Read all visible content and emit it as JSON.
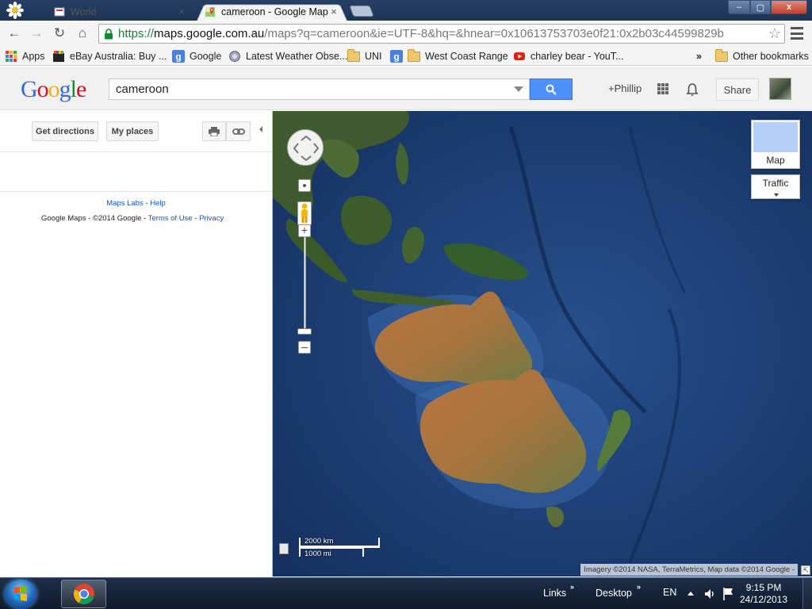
{
  "browser": {
    "tabs": [
      {
        "label": "World",
        "active": false
      },
      {
        "label": "cameroon - Google Maps",
        "active": true
      }
    ],
    "close_glyph": "×",
    "window_controls": {
      "minimize": "–",
      "maximize": "▢",
      "close": "x"
    },
    "url": {
      "scheme": "https://",
      "host": "maps.google.com.au",
      "rest": "/maps?q=cameroon&ie=UTF-8&hq=&hnear=0x10613753703e0f21:0x2b03c44599829b"
    },
    "nav": {
      "back": "←",
      "forward": "→",
      "reload": "↻",
      "home": "⌂",
      "star": "☆"
    }
  },
  "bookmarks": {
    "items": [
      {
        "label": "Apps",
        "icon": "apps-grid-icon"
      },
      {
        "label": "eBay Australia: Buy ...",
        "icon": "ebay-icon"
      },
      {
        "label": "Google",
        "icon": "google-g-icon"
      },
      {
        "label": "Latest Weather Obse...",
        "icon": "weather-icon"
      },
      {
        "label": "UNI",
        "icon": "folder-icon"
      },
      {
        "label": "West Coast Range",
        "icon": "google-g-icon"
      },
      {
        "label": "charley bear - YouT...",
        "icon": "youtube-icon"
      }
    ],
    "overflow": "»",
    "other": "Other bookmarks"
  },
  "maps_header": {
    "logo": [
      "G",
      "o",
      "o",
      "g",
      "l",
      "e"
    ],
    "logo_colors": [
      "#3369e8",
      "#d50f25",
      "#eeb211",
      "#3369e8",
      "#009925",
      "#d50f25"
    ],
    "search_value": "cameroon",
    "user": "+Phillip",
    "share": "Share"
  },
  "left_panel": {
    "get_directions": "Get directions",
    "my_places": "My places",
    "maps_labs": "Maps Labs",
    "labs_sep": " - ",
    "help": "Help",
    "footer_brand": "Google Maps",
    "footer_copy": " - ©2014 Google - ",
    "terms": "Terms of Use",
    "footer_sep": " - ",
    "privacy": "Privacy"
  },
  "map": {
    "map_type_label": "Map",
    "traffic_label": "Traffic",
    "zoom_in": "+",
    "zoom_out": "–",
    "scale_km": "2000 km",
    "scale_mi": "1000 mi",
    "attribution": "Imagery ©2014 NASA, TerraMetrics, Map data ©2014 Google -",
    "resize": "⇱"
  },
  "taskbar": {
    "links": "Links",
    "desktop": "Desktop",
    "language": "EN",
    "chevron": "»",
    "time": "9:15 PM",
    "date": "24/12/2013"
  }
}
